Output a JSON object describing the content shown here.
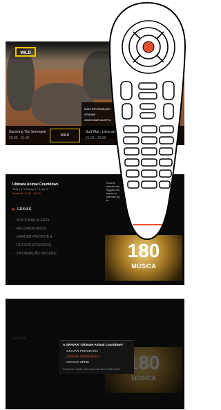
{
  "tv_screen": {
    "channel_logo": "WILD",
    "info_menu": [
      "MAIS INFORMAÇÃO",
      "GRAVAR",
      "ADICIONAR ALERTA"
    ],
    "program_left": "Surviving The Serengeti",
    "program_left_time": "20:00 - 21:00",
    "thumb_logo": "WILD",
    "program_right": "Surf War : Lions and",
    "program_right_time": "21:00 - 22:00"
  },
  "details": {
    "title": "Ultimate Animal Countdown",
    "subtitle": "2011 | 47 Minutos | T 3, Ep. 6",
    "time": "Amanhã, 20:30 - 21:20",
    "description": "Runner determ the biggest the fastest d ultimate fig fa",
    "menu": [
      {
        "label": "GRAVAR",
        "active": true
      },
      {
        "label": "ADICIONAR ALERTA",
        "active": false
      },
      {
        "label": "RECOMENDADOS",
        "active": false
      },
      {
        "label": "MARCAR FAVORITE ♥",
        "active": false
      },
      {
        "label": "OUTROS EPISÓDIOS",
        "active": false
      },
      {
        "label": "INFORMAÇÃO DA SÉRIE",
        "active": false
      }
    ],
    "promo_number": "180",
    "promo_word": "MÚSICA"
  },
  "record_popup": {
    "header": "A GRAVAR \"Ultimate Animal Countdown\"",
    "options": [
      {
        "label": "GRAVAR PROGRAMA",
        "active": false
      },
      {
        "label": "GRAVAR TEMPORADA",
        "active": true
      },
      {
        "label": "GRAVAR SÉRIE",
        "active": false
      }
    ],
    "hint": "Pressione o botão Voltar para sair das Configurações",
    "background_item": "GRAVAR"
  },
  "colors": {
    "accent": "#e8502a",
    "ok_button": "#e8502a",
    "logo_frame": "#f5c400"
  }
}
